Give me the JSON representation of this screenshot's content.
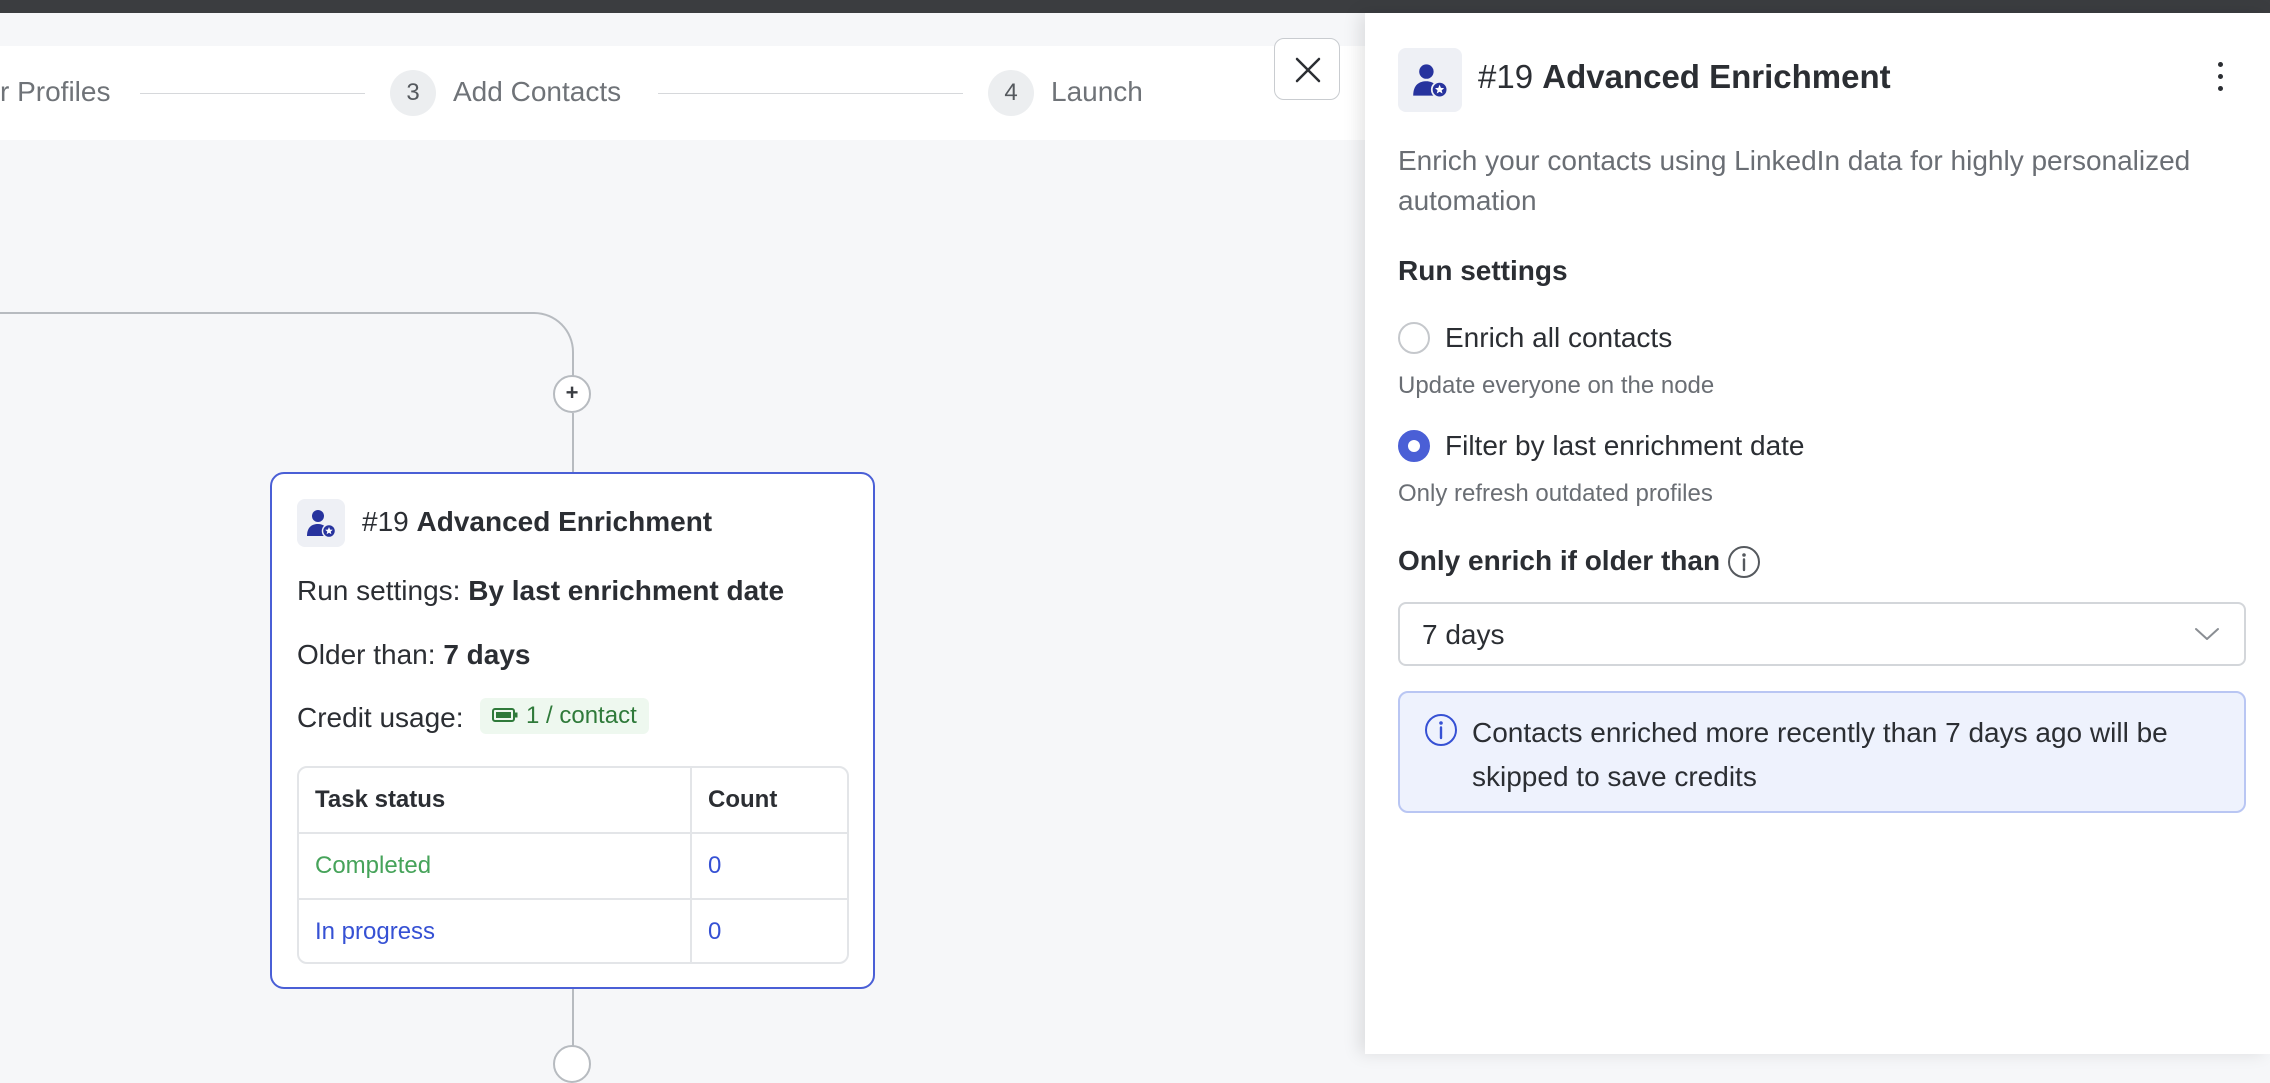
{
  "stepper": {
    "steps": [
      {
        "number": "",
        "label": "r Profiles"
      },
      {
        "number": "3",
        "label": "Add Contacts"
      },
      {
        "number": "4",
        "label": "Launch"
      }
    ]
  },
  "canvas": {
    "add_label": "+",
    "node": {
      "title_prefix": "#19",
      "title_main": "Advanced Enrichment",
      "run_settings_label": "Run settings:",
      "run_settings_value": "By last enrichment date",
      "older_than_label": "Older than:",
      "older_than_value": "7 days",
      "credit_label": "Credit usage:",
      "credit_value": "1 / contact",
      "table": {
        "headers": [
          "Task status",
          "Count"
        ],
        "rows": [
          {
            "status": "Completed",
            "count": "0"
          },
          {
            "status": "In progress",
            "count": "0"
          }
        ]
      }
    }
  },
  "panel": {
    "title_prefix": "#19",
    "title_main": "Advanced Enrichment",
    "description": "Enrich your contacts using LinkedIn data for highly personalized automation",
    "section_title": "Run settings",
    "options": [
      {
        "label": "Enrich all contacts",
        "sub": "Update everyone on the node",
        "checked": false
      },
      {
        "label": "Filter by last enrichment date",
        "sub": "Only refresh outdated profiles",
        "checked": true
      }
    ],
    "field_label": "Only enrich if older than",
    "select_value": "7 days",
    "notice": "Contacts enriched more recently than 7 days ago will be skipped to save credits"
  },
  "colors": {
    "accent": "#4a5fd6",
    "completed": "#46a35a",
    "in_progress": "#3651d4",
    "credit": "#2f7a3a"
  },
  "icons": {
    "node": "user-star-icon",
    "close": "close-icon",
    "menu": "kebab-menu-icon",
    "info": "info-icon",
    "select": "chevron-down-icon",
    "credit": "battery-icon"
  }
}
